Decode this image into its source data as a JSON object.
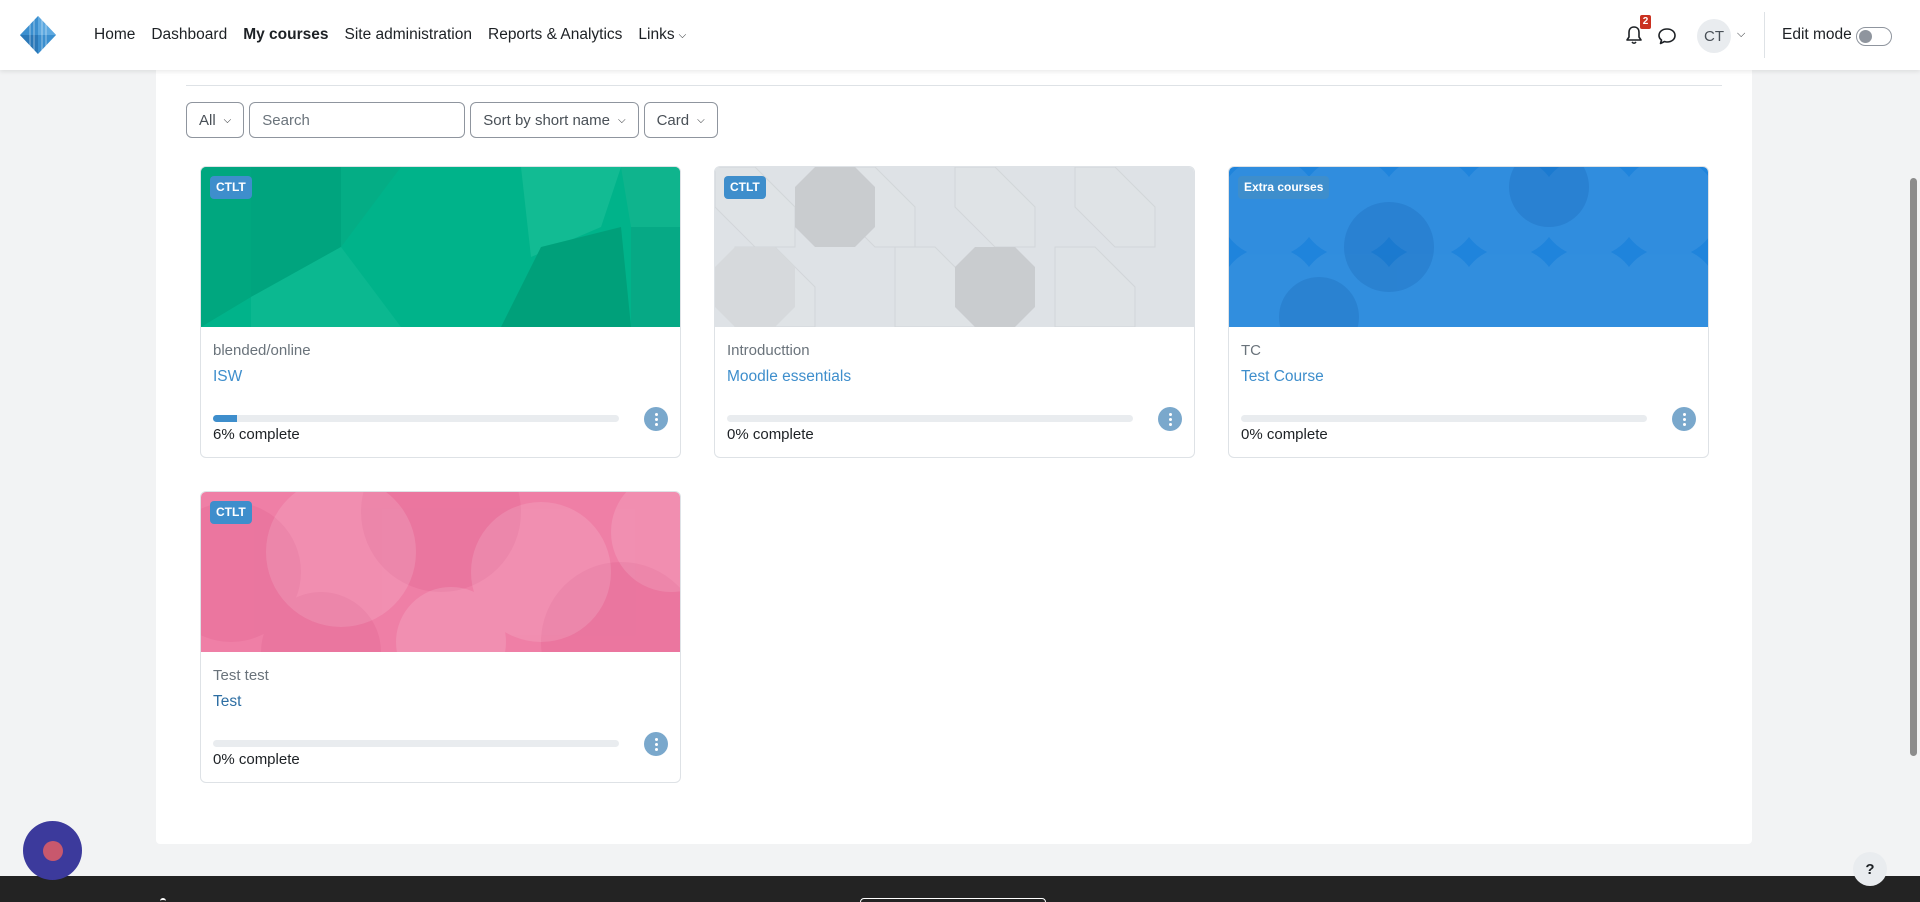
{
  "nav": {
    "items": [
      {
        "label": "Home",
        "active": false
      },
      {
        "label": "Dashboard",
        "active": false
      },
      {
        "label": "My courses",
        "active": true
      },
      {
        "label": "Site administration",
        "active": false
      },
      {
        "label": "Reports & Analytics",
        "active": false
      },
      {
        "label": "Links",
        "active": false
      }
    ],
    "notification_count": "2",
    "user_initials": "CT",
    "edit_mode_label": "Edit mode",
    "edit_mode_on": false
  },
  "filters": {
    "grouping": "All",
    "search_placeholder": "Search",
    "sort": "Sort by short name",
    "view": "Card"
  },
  "courses": [
    {
      "badge": "CTLT",
      "category": "blended/online",
      "name": "ISW",
      "progress": 6,
      "progress_label": "6% complete",
      "pattern": "green-polygons"
    },
    {
      "badge": "CTLT",
      "category": "Introducttion",
      "name": "Moodle essentials",
      "progress": 0,
      "progress_label": "0% complete",
      "pattern": "gray-octagons"
    },
    {
      "badge": "Extra courses",
      "category": "TC",
      "name": "Test Course",
      "progress": 0,
      "progress_label": "0% complete",
      "pattern": "blue-circles"
    },
    {
      "badge": "CTLT",
      "category": "Test test",
      "name": "Test",
      "progress": 0,
      "progress_label": "0% complete",
      "pattern": "pink-circles"
    }
  ],
  "colors": {
    "accent": "#3e8ecc",
    "green": "#00b38a",
    "gray": "#dee2e6",
    "blue": "#1f84dc",
    "pink": "#ef7fa6"
  },
  "help_label": "?"
}
